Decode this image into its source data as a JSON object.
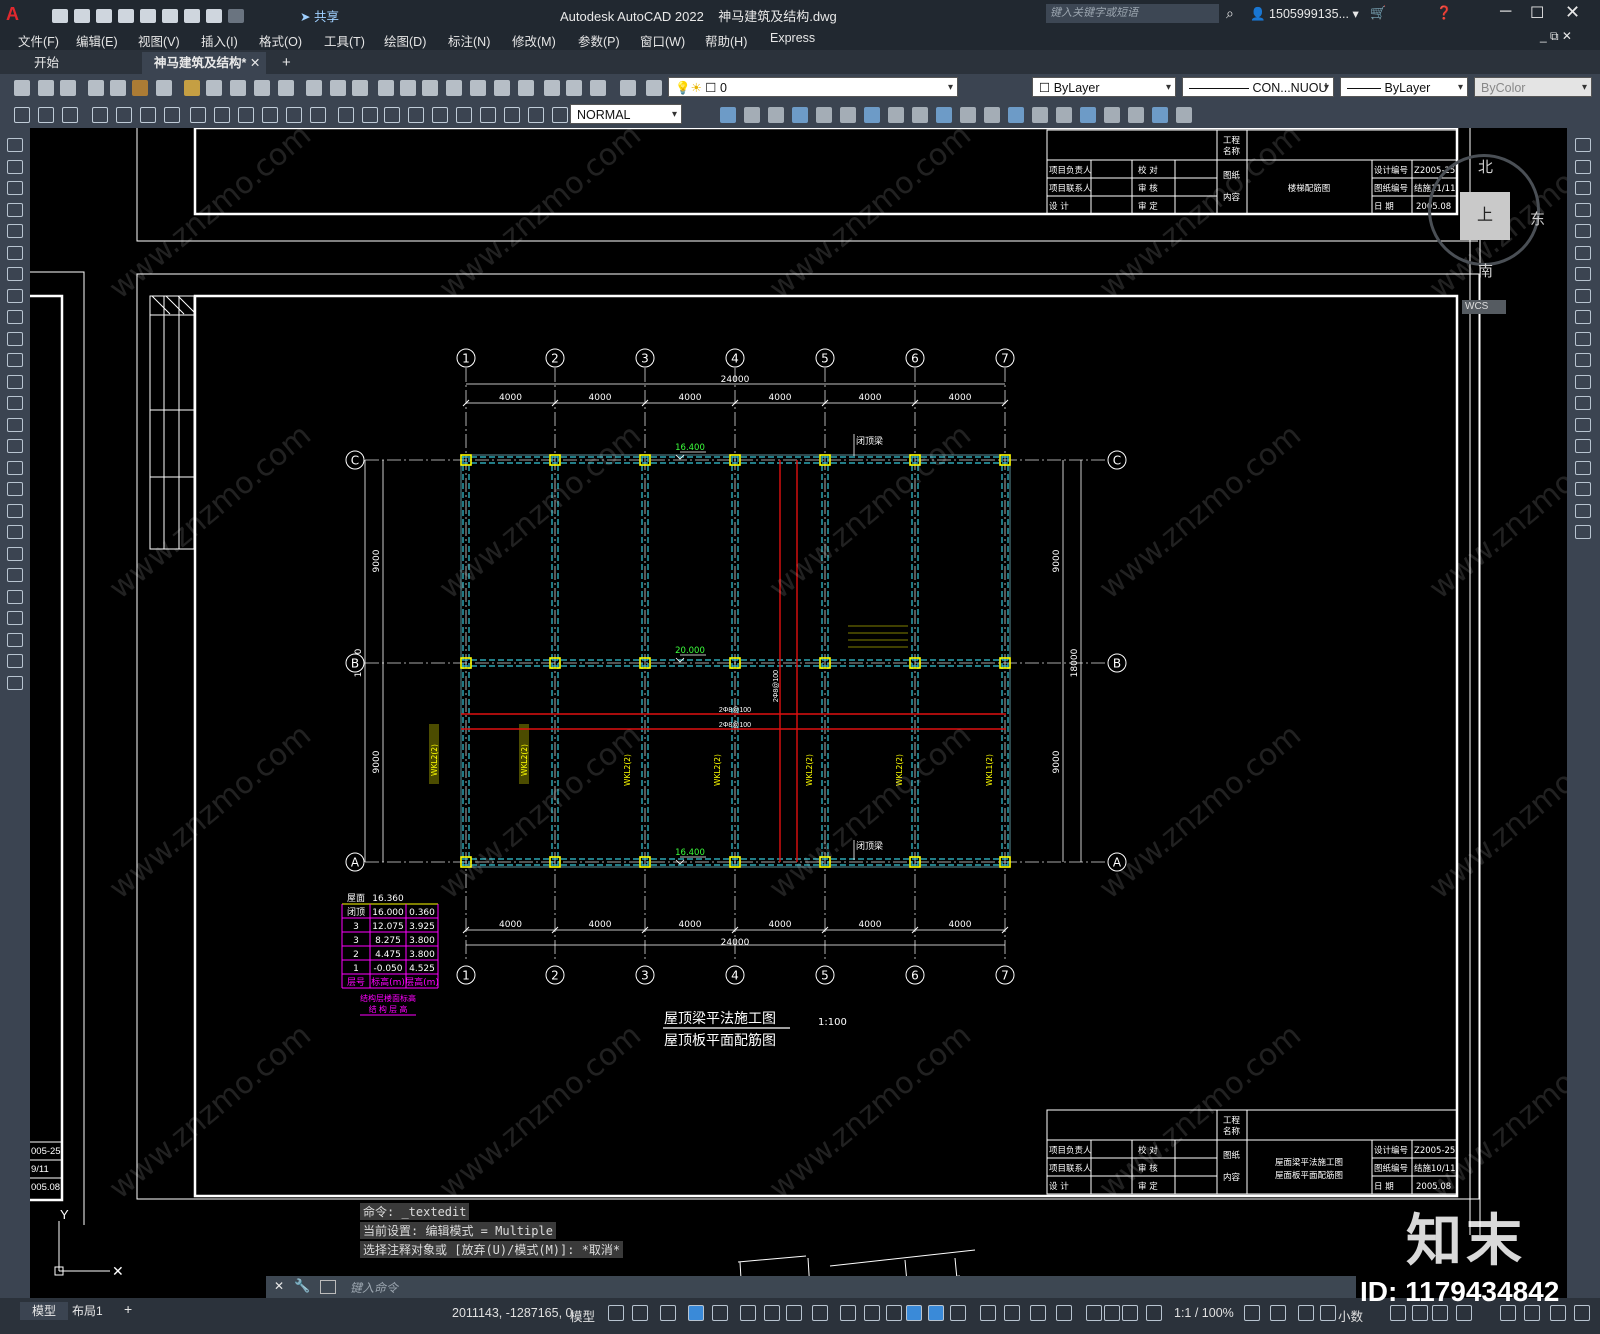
{
  "app": {
    "title": "Autodesk AutoCAD 2022",
    "filename": "神马建筑及结构.dwg",
    "share_label": "共享",
    "search_placeholder": "键入关键字或短语",
    "user": "1505999135..."
  },
  "menu": [
    "文件(F)",
    "编辑(E)",
    "视图(V)",
    "插入(I)",
    "格式(O)",
    "工具(T)",
    "绘图(D)",
    "标注(N)",
    "修改(M)",
    "参数(P)",
    "窗口(W)",
    "帮助(H)",
    "Express"
  ],
  "tabs": [
    {
      "label": "开始"
    },
    {
      "label": "神马建筑及结构*"
    }
  ],
  "toolbar": {
    "layer_value": "0",
    "color_value": "ByLayer",
    "linetype_value": "CON...NUOU",
    "lineweight_value": "ByLayer",
    "plotstyle_value": "ByColor",
    "dimstyle_value": "NORMAL"
  },
  "viewcube": {
    "north": "北",
    "east": "东",
    "south": "南",
    "top": "上",
    "wcs": "WCS"
  },
  "drawing": {
    "grid_cols": [
      "1",
      "2",
      "3",
      "4",
      "5",
      "6",
      "7"
    ],
    "grid_rows": [
      "C",
      "B",
      "A"
    ],
    "span_dims": [
      "4000",
      "4000",
      "4000",
      "4000",
      "4000",
      "4000"
    ],
    "total_x": "24000",
    "row_dims": [
      "9000",
      "9000"
    ],
    "total_y": "18000",
    "elev_top": "16.400",
    "elev_mid": "20.000",
    "elev_bot": "16.400",
    "note_top": "闭顶梁",
    "note_bot": "闭顶梁",
    "title_line1": "屋顶梁平法施工图",
    "title_line2": "屋顶板平面配筋图",
    "scale": "1:100",
    "beam_labels": [
      "WKL2(2)",
      "WKL2(2)",
      "WKL2(2)",
      "WKL2(2)",
      "WKL2(2)",
      "WKL1(2)"
    ],
    "beam_mid_labels": [
      "2Φ8@100",
      "2Φ8@100",
      "2Φ8@100"
    ]
  },
  "level_table": {
    "header": [
      "屋面",
      "16.360",
      ""
    ],
    "rows": [
      [
        "闭顶",
        "16.000",
        "0.360"
      ],
      [
        "3",
        "12.075",
        "3.925"
      ],
      [
        "3",
        "8.275",
        "3.800"
      ],
      [
        "2",
        "4.475",
        "3.800"
      ],
      [
        "1",
        "-0.050",
        "4.525"
      ]
    ],
    "footer": [
      "层号",
      "标高(m)",
      "层高(m)"
    ],
    "caption1": "结构层楼面标高",
    "caption2": "结 构 层 高"
  },
  "title_block_top": {
    "project_name_label": "工程名称",
    "rows": [
      [
        "项目负责人",
        "校 对"
      ],
      [
        "项目联系人",
        "审 核"
      ],
      [
        "设 计",
        "审 定"
      ]
    ],
    "drawing_label": "图纸",
    "content_label": "内容",
    "content": "楼梯配筋图",
    "design_no_label": "设计编号",
    "design_no": "Z2005-25",
    "sheet_no_label": "图纸编号",
    "sheet_no": "结施11/11",
    "date_label": "日 期",
    "date": "2005.08"
  },
  "title_block_bottom": {
    "project_name_label": "工程名称",
    "rows": [
      [
        "项目负责人",
        "校 对"
      ],
      [
        "项目联系人",
        "审 核"
      ],
      [
        "设 计",
        "审 定"
      ]
    ],
    "drawing_label": "图纸",
    "content_label": "内容",
    "content1": "屋面梁平法施工图",
    "content2": "屋面板平面配筋图",
    "design_no_label": "设计编号",
    "design_no": "Z2005-25",
    "sheet_no_label": "图纸编号",
    "sheet_no": "结施10/11",
    "date_label": "日 期",
    "date": "2005.08"
  },
  "left_partial": {
    "l1": "005-25",
    "l2": "9/11",
    "l3": "005.08"
  },
  "command": {
    "line1": "命令: _textedit",
    "line2": "当前设置: 编辑模式 = Multiple",
    "line3": "选择注释对象或 [放弃(U)/模式(M)]: *取消*",
    "input_placeholder": "键入命令"
  },
  "status": {
    "layout_tabs": [
      "模型",
      "布局1"
    ],
    "coords": "2011143, -1287165, 0",
    "model": "模型",
    "scale": "1:1 / 100%",
    "units": "小数"
  },
  "watermark": {
    "brand": "知末",
    "id": "ID: 1179434842"
  }
}
